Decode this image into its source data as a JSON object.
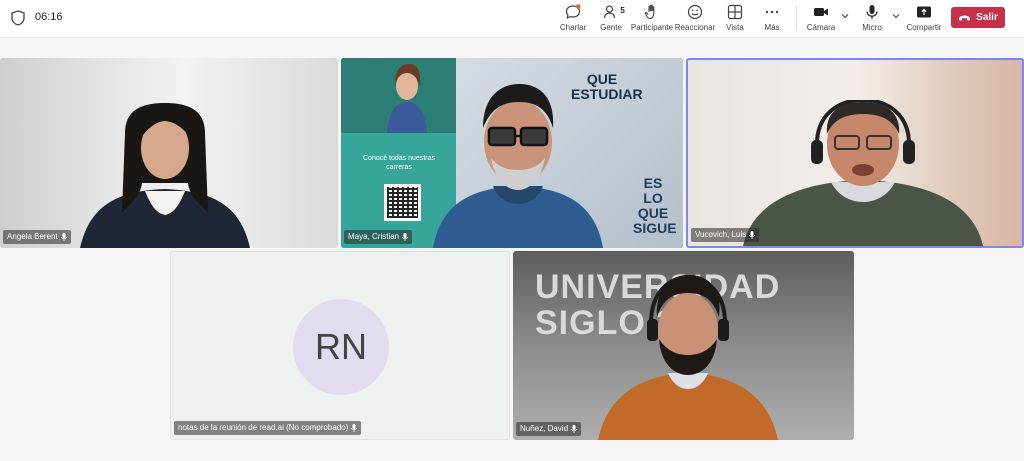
{
  "toolbar": {
    "timer": "06:16",
    "chat_label": "Charlar",
    "people_label": "Gente",
    "people_count": "5",
    "participant_label": "Participante",
    "react_label": "Reaccionar",
    "view_label": "Vista",
    "more_label": "Más",
    "camera_label": "Cámara",
    "mic_label": "Micro",
    "share_label": "Compartir",
    "leave_label": "Salir"
  },
  "colors": {
    "leave": "#c4314b",
    "active_speaker_border": "#7f85f5",
    "avatar_bg": "#e3dcef"
  },
  "participants": [
    {
      "name": "Angela Berent",
      "mic": "mic-icon"
    },
    {
      "name": "Maya, Cristian",
      "mic": "mic-icon"
    },
    {
      "name": "Vucovich, Luis",
      "mic": "mic-icon"
    },
    {
      "name": "notas de la reunión de read.ai (No comprobado)",
      "initials": "RN",
      "mic": "mic-icon"
    },
    {
      "name": "Nuñez, David",
      "mic": "mic-icon"
    }
  ],
  "background_content": {
    "promo_line": "Conocé todas nuestras carreras",
    "headline_top": "QUE ESTUDIAR",
    "headline_bottom": "ES LO QUE SIGUE",
    "wall_brand": "UNIVERSIDAD SIGLO 21"
  }
}
